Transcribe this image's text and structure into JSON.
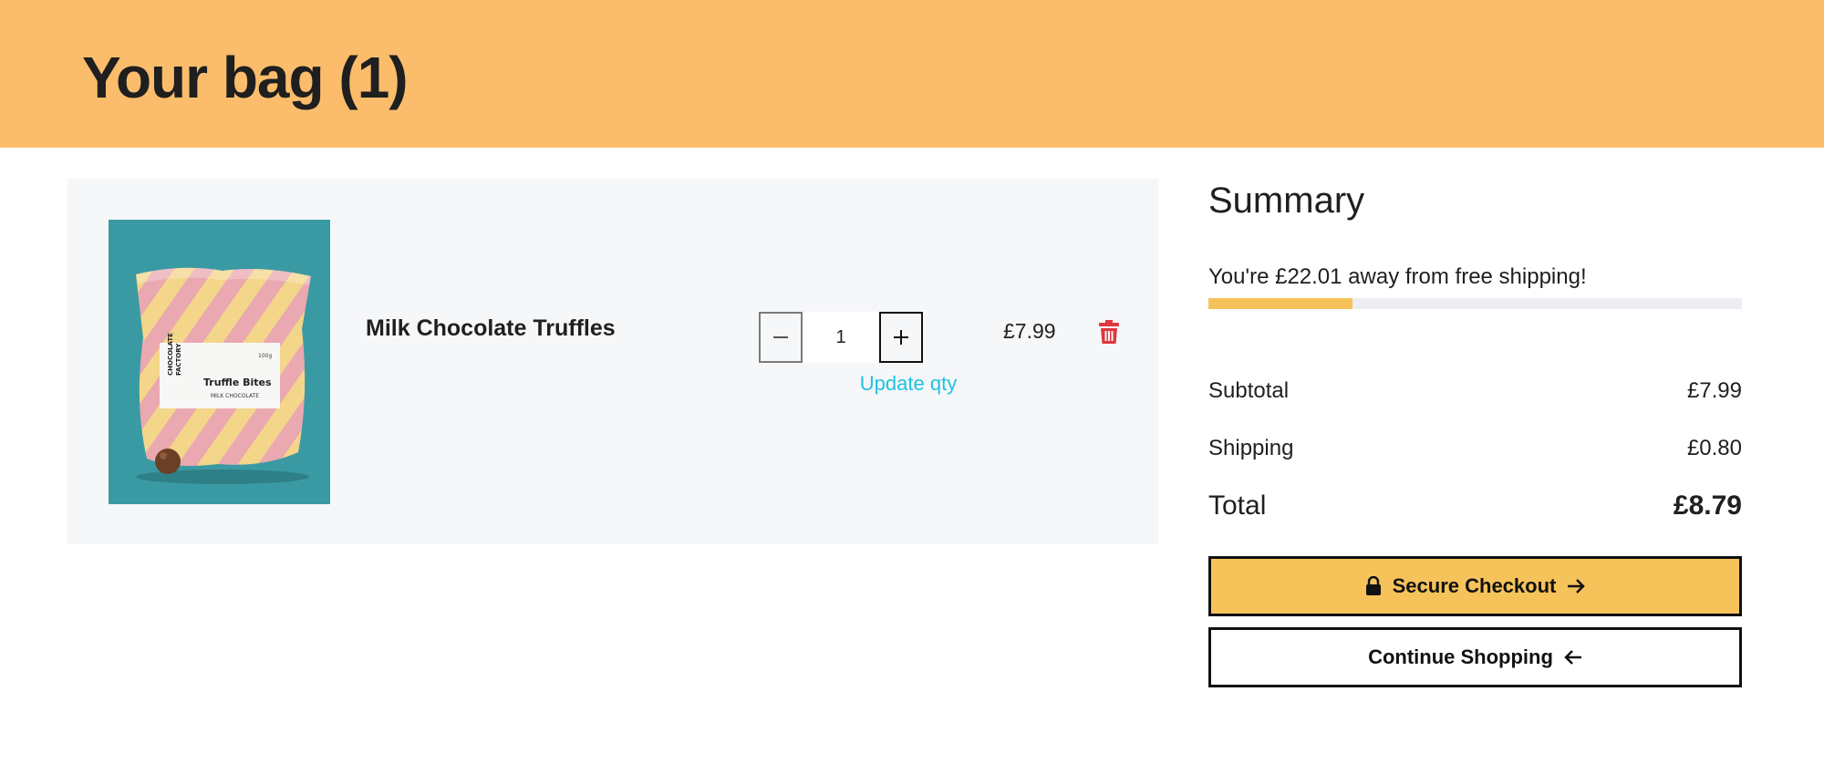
{
  "header": {
    "title": "Your bag (1)"
  },
  "cart": {
    "items": [
      {
        "name": "Milk Chocolate Truffles",
        "quantity": "1",
        "update_label": "Update qty",
        "price": "£7.99",
        "image": {
          "brand_line1": "CHOCOLATE",
          "brand_line2": "FACTORY",
          "weight": "100g",
          "product_title": "Truffle Bites",
          "product_subtitle": "MILK CHOCOLATE"
        }
      }
    ]
  },
  "summary": {
    "title": "Summary",
    "free_shipping_text": "You're £22.01 away from free shipping!",
    "free_shipping_progress": 0.27,
    "subtotal_label": "Subtotal",
    "subtotal_value": "£7.99",
    "shipping_label": "Shipping",
    "shipping_value": "£0.80",
    "total_label": "Total",
    "total_value": "£8.79",
    "checkout_label": "Secure Checkout",
    "continue_label": "Continue Shopping"
  },
  "icons": {
    "minus": "minus-icon",
    "plus": "plus-icon",
    "delete": "trash-icon",
    "lock": "lock-icon",
    "arrow_right": "arrow-right-icon",
    "arrow_left": "arrow-left-icon"
  },
  "colors": {
    "header_bg": "#fbbd6c",
    "accent": "#f6c35a",
    "link": "#1ec3e0",
    "delete": "#e0383e",
    "image_bg": "#3a9aa3"
  }
}
